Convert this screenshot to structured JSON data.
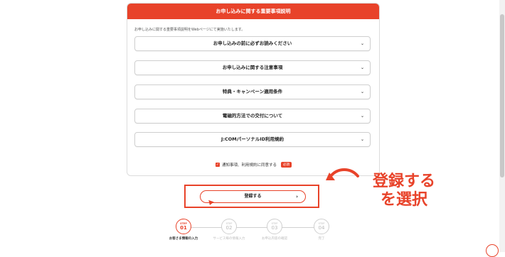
{
  "card": {
    "title": "お申し込みに関する重要事項説明",
    "intro": "お申し込みに関する重要事項説明をWebページにて実施いたします。"
  },
  "accordions": [
    {
      "label": "お申し込みの前に必ずお読みください"
    },
    {
      "label": "お申し込みに関する注意事項"
    },
    {
      "label": "特典・キャンペーン適用条件"
    },
    {
      "label": "電磁的方法での交付について"
    },
    {
      "label": "J:COMパーソナルID利用規約"
    }
  ],
  "agree": {
    "label": "通知事項、利用規約に同意する",
    "required": "必須",
    "checked": true
  },
  "register_button": {
    "label": "登録する"
  },
  "annotation": {
    "line1": "登録する",
    "line2": "を選択",
    "color": "#e8432a"
  },
  "steps": [
    {
      "step": "STEP",
      "num": "01",
      "label": "お客さま情報の入力",
      "active": true
    },
    {
      "step": "STEP",
      "num": "02",
      "label": "サービス毎の情報入力",
      "active": false
    },
    {
      "step": "STEP",
      "num": "03",
      "label": "お申込内容の確認",
      "active": false
    },
    {
      "step": "STEP",
      "num": "04",
      "label": "完了",
      "active": false
    }
  ],
  "colors": {
    "accent": "#e8432a",
    "border": "#cfcfcf"
  }
}
